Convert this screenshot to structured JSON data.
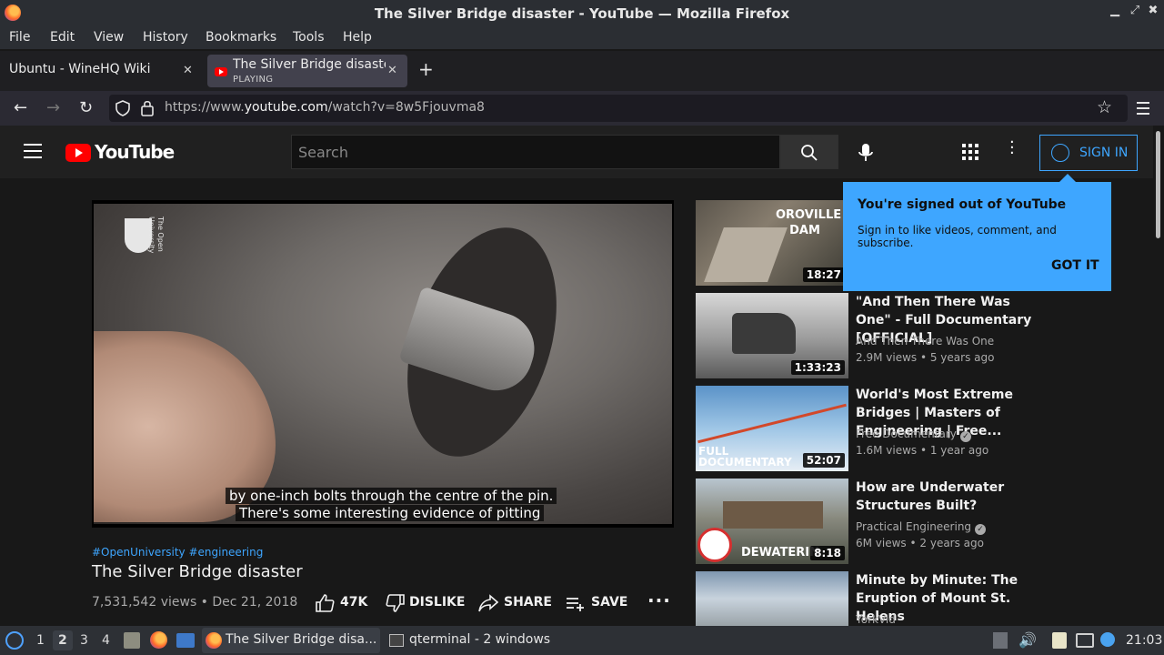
{
  "window": {
    "title": "The Silver Bridge disaster - YouTube — Mozilla Firefox"
  },
  "menubar": [
    "File",
    "Edit",
    "View",
    "History",
    "Bookmarks",
    "Tools",
    "Help"
  ],
  "tabs": [
    {
      "label": "Ubuntu - WineHQ Wiki",
      "active": false
    },
    {
      "label": "The Silver Bridge disaste",
      "sub": "PLAYING",
      "active": true
    }
  ],
  "address": {
    "prefix": "https://www.",
    "domain": "youtube.com",
    "path": "/watch?v=8w5Fjouvma8"
  },
  "youtube": {
    "logo_text": "YouTube",
    "search_placeholder": "Search",
    "signin_label": "SIGN IN",
    "accent": "#3ea6ff"
  },
  "video": {
    "caption_line1": "by one-inch bolts through the centre of the pin.",
    "caption_line2": "There's some interesting evidence of pitting",
    "channel_watermark": "The Open University",
    "tags": "#OpenUniversity #engineering",
    "title": "The Silver Bridge disaster",
    "views_date": "7,531,542 views • Dec 21, 2018",
    "likes": "47K",
    "dislike_label": "DISLIKE",
    "share_label": "SHARE",
    "save_label": "SAVE"
  },
  "popup": {
    "heading": "You're signed out of YouTube",
    "body": "Sign in to like videos, comment, and subscribe.",
    "button": "GOT IT"
  },
  "recommendations": [
    {
      "thumb_text": "OROVILLE DAM",
      "duration": "18:27"
    },
    {
      "title": "\"And Then There Was One\" - Full Documentary [OFFICIAL]",
      "channel": "And Then There Was One",
      "verified": false,
      "meta": "2.9M views • 5 years ago",
      "duration": "1:33:23"
    },
    {
      "title": "World's Most Extreme Bridges | Masters of Engineering | Free...",
      "channel": "Free Documentary",
      "verified": true,
      "meta": "1.6M views • 1 year ago",
      "duration": "52:07",
      "thumb_text": "FULL DOCUMENTARY"
    },
    {
      "title": "How are Underwater Structures Built?",
      "channel": "Practical Engineering",
      "verified": true,
      "meta": "6M views • 2 years ago",
      "duration": "8:18",
      "thumb_text": "DEWATERIN"
    },
    {
      "title": "Minute by Minute: The Eruption of Mount St. Helens",
      "channel": "YorkVid",
      "verified": false
    }
  ],
  "taskbar": {
    "desktops": [
      "1",
      "2",
      "3",
      "4"
    ],
    "tasks": [
      "The Silver Bridge disa...",
      "qterminal - 2 windows"
    ],
    "clock": "21:03"
  }
}
